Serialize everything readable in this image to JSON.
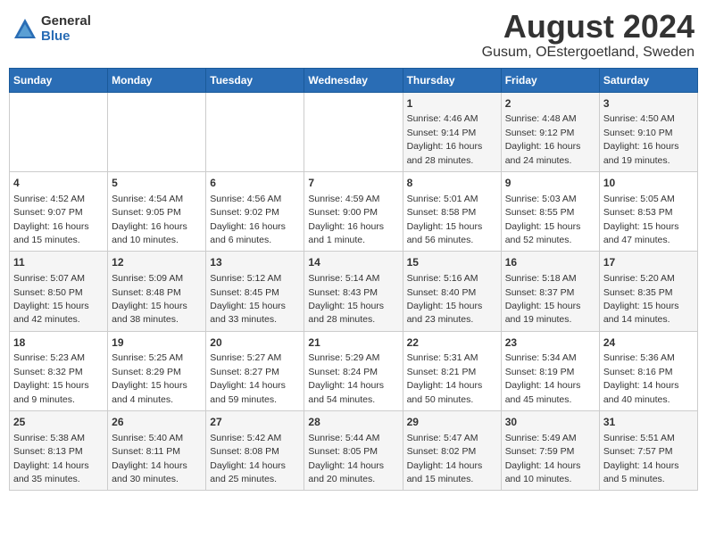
{
  "header": {
    "logo_general": "General",
    "logo_blue": "Blue",
    "title": "August 2024",
    "subtitle": "Gusum, OEstergoetland, Sweden"
  },
  "days_of_week": [
    "Sunday",
    "Monday",
    "Tuesday",
    "Wednesday",
    "Thursday",
    "Friday",
    "Saturday"
  ],
  "weeks": [
    [
      {
        "day": "",
        "info": ""
      },
      {
        "day": "",
        "info": ""
      },
      {
        "day": "",
        "info": ""
      },
      {
        "day": "",
        "info": ""
      },
      {
        "day": "1",
        "info": "Sunrise: 4:46 AM\nSunset: 9:14 PM\nDaylight: 16 hours\nand 28 minutes."
      },
      {
        "day": "2",
        "info": "Sunrise: 4:48 AM\nSunset: 9:12 PM\nDaylight: 16 hours\nand 24 minutes."
      },
      {
        "day": "3",
        "info": "Sunrise: 4:50 AM\nSunset: 9:10 PM\nDaylight: 16 hours\nand 19 minutes."
      }
    ],
    [
      {
        "day": "4",
        "info": "Sunrise: 4:52 AM\nSunset: 9:07 PM\nDaylight: 16 hours\nand 15 minutes."
      },
      {
        "day": "5",
        "info": "Sunrise: 4:54 AM\nSunset: 9:05 PM\nDaylight: 16 hours\nand 10 minutes."
      },
      {
        "day": "6",
        "info": "Sunrise: 4:56 AM\nSunset: 9:02 PM\nDaylight: 16 hours\nand 6 minutes."
      },
      {
        "day": "7",
        "info": "Sunrise: 4:59 AM\nSunset: 9:00 PM\nDaylight: 16 hours\nand 1 minute."
      },
      {
        "day": "8",
        "info": "Sunrise: 5:01 AM\nSunset: 8:58 PM\nDaylight: 15 hours\nand 56 minutes."
      },
      {
        "day": "9",
        "info": "Sunrise: 5:03 AM\nSunset: 8:55 PM\nDaylight: 15 hours\nand 52 minutes."
      },
      {
        "day": "10",
        "info": "Sunrise: 5:05 AM\nSunset: 8:53 PM\nDaylight: 15 hours\nand 47 minutes."
      }
    ],
    [
      {
        "day": "11",
        "info": "Sunrise: 5:07 AM\nSunset: 8:50 PM\nDaylight: 15 hours\nand 42 minutes."
      },
      {
        "day": "12",
        "info": "Sunrise: 5:09 AM\nSunset: 8:48 PM\nDaylight: 15 hours\nand 38 minutes."
      },
      {
        "day": "13",
        "info": "Sunrise: 5:12 AM\nSunset: 8:45 PM\nDaylight: 15 hours\nand 33 minutes."
      },
      {
        "day": "14",
        "info": "Sunrise: 5:14 AM\nSunset: 8:43 PM\nDaylight: 15 hours\nand 28 minutes."
      },
      {
        "day": "15",
        "info": "Sunrise: 5:16 AM\nSunset: 8:40 PM\nDaylight: 15 hours\nand 23 minutes."
      },
      {
        "day": "16",
        "info": "Sunrise: 5:18 AM\nSunset: 8:37 PM\nDaylight: 15 hours\nand 19 minutes."
      },
      {
        "day": "17",
        "info": "Sunrise: 5:20 AM\nSunset: 8:35 PM\nDaylight: 15 hours\nand 14 minutes."
      }
    ],
    [
      {
        "day": "18",
        "info": "Sunrise: 5:23 AM\nSunset: 8:32 PM\nDaylight: 15 hours\nand 9 minutes."
      },
      {
        "day": "19",
        "info": "Sunrise: 5:25 AM\nSunset: 8:29 PM\nDaylight: 15 hours\nand 4 minutes."
      },
      {
        "day": "20",
        "info": "Sunrise: 5:27 AM\nSunset: 8:27 PM\nDaylight: 14 hours\nand 59 minutes."
      },
      {
        "day": "21",
        "info": "Sunrise: 5:29 AM\nSunset: 8:24 PM\nDaylight: 14 hours\nand 54 minutes."
      },
      {
        "day": "22",
        "info": "Sunrise: 5:31 AM\nSunset: 8:21 PM\nDaylight: 14 hours\nand 50 minutes."
      },
      {
        "day": "23",
        "info": "Sunrise: 5:34 AM\nSunset: 8:19 PM\nDaylight: 14 hours\nand 45 minutes."
      },
      {
        "day": "24",
        "info": "Sunrise: 5:36 AM\nSunset: 8:16 PM\nDaylight: 14 hours\nand 40 minutes."
      }
    ],
    [
      {
        "day": "25",
        "info": "Sunrise: 5:38 AM\nSunset: 8:13 PM\nDaylight: 14 hours\nand 35 minutes."
      },
      {
        "day": "26",
        "info": "Sunrise: 5:40 AM\nSunset: 8:11 PM\nDaylight: 14 hours\nand 30 minutes."
      },
      {
        "day": "27",
        "info": "Sunrise: 5:42 AM\nSunset: 8:08 PM\nDaylight: 14 hours\nand 25 minutes."
      },
      {
        "day": "28",
        "info": "Sunrise: 5:44 AM\nSunset: 8:05 PM\nDaylight: 14 hours\nand 20 minutes."
      },
      {
        "day": "29",
        "info": "Sunrise: 5:47 AM\nSunset: 8:02 PM\nDaylight: 14 hours\nand 15 minutes."
      },
      {
        "day": "30",
        "info": "Sunrise: 5:49 AM\nSunset: 7:59 PM\nDaylight: 14 hours\nand 10 minutes."
      },
      {
        "day": "31",
        "info": "Sunrise: 5:51 AM\nSunset: 7:57 PM\nDaylight: 14 hours\nand 5 minutes."
      }
    ]
  ]
}
